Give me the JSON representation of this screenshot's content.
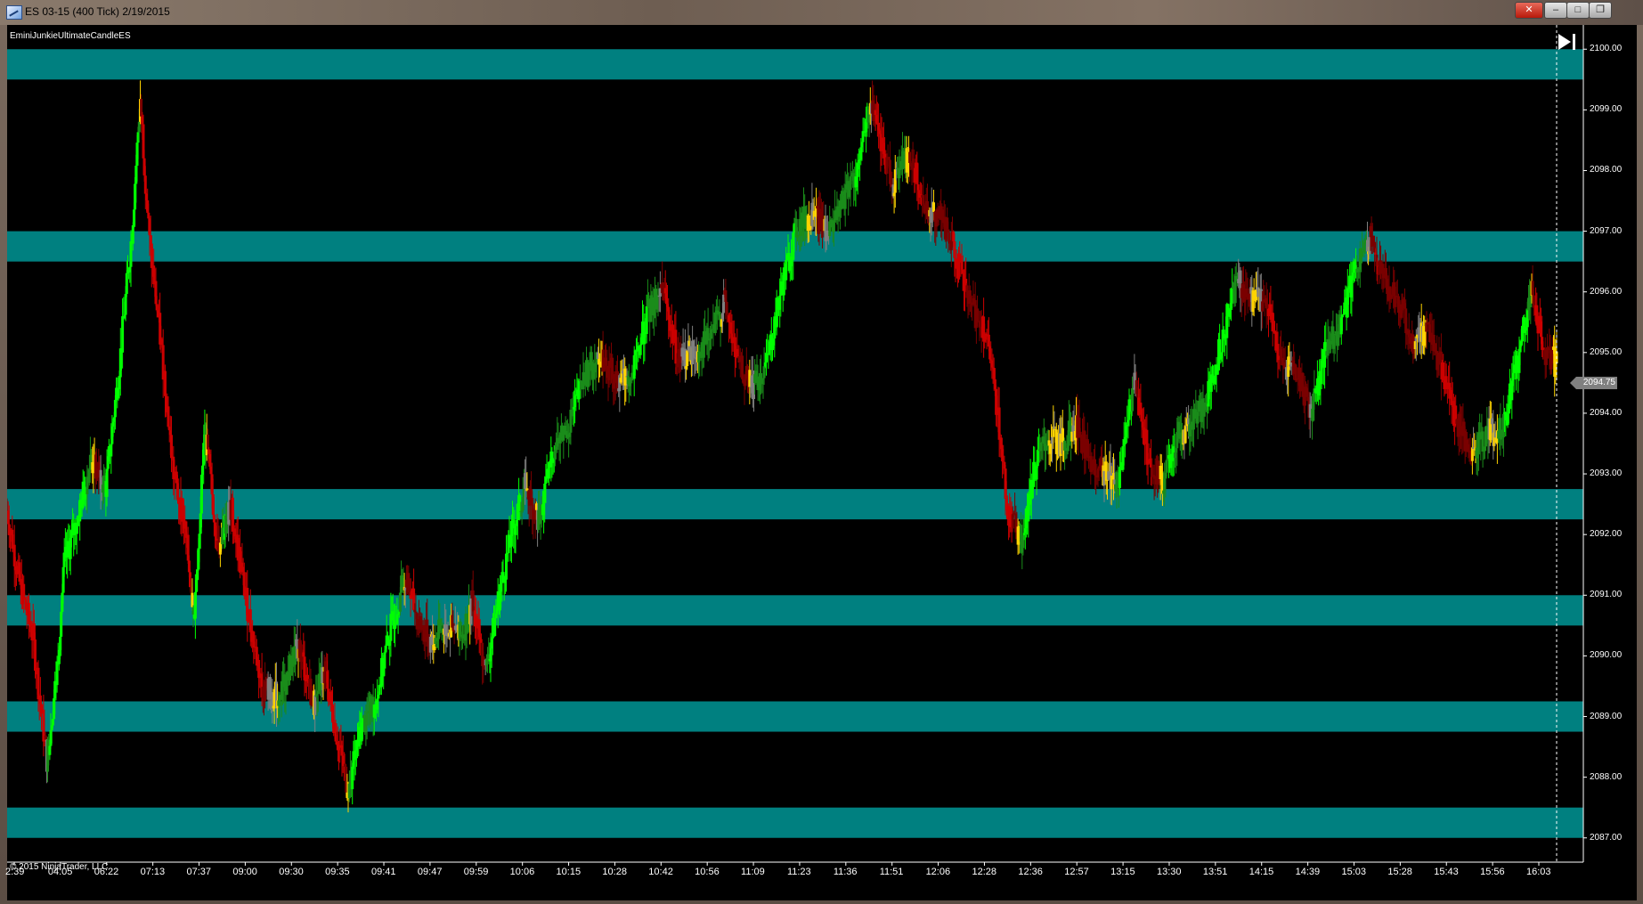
{
  "window": {
    "title": "ES 03-15 (400 Tick)  2/19/2015",
    "close_label": "✕",
    "min_label": "–",
    "max_label": "□",
    "restore_label": "❐"
  },
  "chart": {
    "indicator_label": "EminiJunkieUltimateCandleES",
    "copyright": "© 2015 NinjaTrader, LLC",
    "last_price_label": "2094.75",
    "scroll_end_icon": "skip-to-end-icon"
  },
  "colors": {
    "background": "#000000",
    "zone": "#008080",
    "up_strong": "#00ff00",
    "up_weak": "#1a8c1a",
    "up_pale": "#4dffb0",
    "down_strong": "#cc0000",
    "down_weak": "#7a0000",
    "neutral": "#ffd400",
    "grey": "#808080",
    "axis_text": "#ffffff"
  },
  "chart_data": {
    "type": "candlestick",
    "instrument": "ES 03-15",
    "period": "400 Tick",
    "date": "2/19/2015",
    "ylim": [
      2086.6,
      2100.4
    ],
    "y_ticks": [
      2087.0,
      2088.0,
      2089.0,
      2090.0,
      2091.0,
      2092.0,
      2093.0,
      2094.0,
      2095.0,
      2096.0,
      2097.0,
      2098.0,
      2099.0,
      2100.0
    ],
    "y_tick_labels": [
      "2087.00",
      "2088.00",
      "2089.00",
      "2090.00",
      "2091.00",
      "2092.00",
      "2093.00",
      "2094.00",
      "2095.00",
      "2096.00",
      "2097.00",
      "2098.00",
      "2099.00",
      "2100.00"
    ],
    "x_tick_labels": [
      "2:39",
      "04:05",
      "06:22",
      "07:13",
      "07:37",
      "09:00",
      "09:30",
      "09:35",
      "09:41",
      "09:47",
      "09:59",
      "10:06",
      "10:15",
      "10:28",
      "10:42",
      "10:56",
      "11:09",
      "11:23",
      "11:36",
      "11:51",
      "12:06",
      "12:28",
      "12:36",
      "12:57",
      "13:15",
      "13:30",
      "13:51",
      "14:15",
      "14:39",
      "15:03",
      "15:28",
      "15:43",
      "15:56",
      "16:03"
    ],
    "zones": [
      {
        "low": 2099.5,
        "high": 2100.0
      },
      {
        "low": 2096.5,
        "high": 2097.0
      },
      {
        "low": 2092.25,
        "high": 2092.75
      },
      {
        "low": 2090.5,
        "high": 2091.0
      },
      {
        "low": 2088.75,
        "high": 2089.25
      },
      {
        "low": 2087.0,
        "high": 2087.5
      }
    ],
    "last_price": 2094.75,
    "price_path": [
      [
        0,
        2092.4
      ],
      [
        12,
        2091.2
      ],
      [
        25,
        2090.3
      ],
      [
        38,
        2088.3
      ],
      [
        47,
        2089.6
      ],
      [
        55,
        2091.5
      ],
      [
        68,
        2092.3
      ],
      [
        80,
        2093.2
      ],
      [
        95,
        2092.8
      ],
      [
        108,
        2094.8
      ],
      [
        120,
        2097.0
      ],
      [
        128,
        2099.2
      ],
      [
        137,
        2096.8
      ],
      [
        150,
        2094.8
      ],
      [
        160,
        2093.0
      ],
      [
        170,
        2092.2
      ],
      [
        180,
        2090.7
      ],
      [
        190,
        2093.7
      ],
      [
        203,
        2091.8
      ],
      [
        215,
        2092.5
      ],
      [
        230,
        2090.9
      ],
      [
        245,
        2089.5
      ],
      [
        262,
        2089.3
      ],
      [
        280,
        2090.2
      ],
      [
        295,
        2089.2
      ],
      [
        305,
        2089.8
      ],
      [
        318,
        2088.6
      ],
      [
        328,
        2087.8
      ],
      [
        340,
        2088.8
      ],
      [
        355,
        2089.3
      ],
      [
        368,
        2090.4
      ],
      [
        382,
        2091.3
      ],
      [
        395,
        2090.6
      ],
      [
        408,
        2090.2
      ],
      [
        422,
        2090.5
      ],
      [
        436,
        2090.3
      ],
      [
        448,
        2090.9
      ],
      [
        460,
        2089.7
      ],
      [
        472,
        2090.9
      ],
      [
        485,
        2092.0
      ],
      [
        498,
        2092.8
      ],
      [
        512,
        2092.2
      ],
      [
        525,
        2093.4
      ],
      [
        540,
        2093.8
      ],
      [
        555,
        2094.6
      ],
      [
        570,
        2095.0
      ],
      [
        585,
        2094.6
      ],
      [
        600,
        2094.5
      ],
      [
        615,
        2095.6
      ],
      [
        630,
        2096.1
      ],
      [
        645,
        2094.9
      ],
      [
        660,
        2095.0
      ],
      [
        675,
        2095.2
      ],
      [
        690,
        2095.8
      ],
      [
        703,
        2094.8
      ],
      [
        716,
        2094.4
      ],
      [
        730,
        2094.8
      ],
      [
        745,
        2096.1
      ],
      [
        760,
        2097.1
      ],
      [
        775,
        2097.3
      ],
      [
        790,
        2097.0
      ],
      [
        805,
        2097.6
      ],
      [
        818,
        2098.0
      ],
      [
        830,
        2099.1
      ],
      [
        840,
        2098.4
      ],
      [
        852,
        2097.8
      ],
      [
        868,
        2098.3
      ],
      [
        882,
        2097.4
      ],
      [
        896,
        2097.3
      ],
      [
        910,
        2096.7
      ],
      [
        925,
        2095.8
      ],
      [
        940,
        2095.4
      ],
      [
        952,
        2094.1
      ],
      [
        962,
        2092.4
      ],
      [
        975,
        2091.9
      ],
      [
        988,
        2093.1
      ],
      [
        1000,
        2093.6
      ],
      [
        1015,
        2093.5
      ],
      [
        1028,
        2093.8
      ],
      [
        1042,
        2093.2
      ],
      [
        1056,
        2093.0
      ],
      [
        1070,
        2092.9
      ],
      [
        1084,
        2094.6
      ],
      [
        1098,
        2093.2
      ],
      [
        1112,
        2092.8
      ],
      [
        1126,
        2093.7
      ],
      [
        1140,
        2093.8
      ],
      [
        1155,
        2094.3
      ],
      [
        1168,
        2095.2
      ],
      [
        1182,
        2096.2
      ],
      [
        1196,
        2095.9
      ],
      [
        1210,
        2095.9
      ],
      [
        1225,
        2094.8
      ],
      [
        1240,
        2094.7
      ],
      [
        1255,
        2094.0
      ],
      [
        1268,
        2095.1
      ],
      [
        1282,
        2095.4
      ],
      [
        1296,
        2096.4
      ],
      [
        1310,
        2096.9
      ],
      [
        1324,
        2096.2
      ],
      [
        1338,
        2095.8
      ],
      [
        1352,
        2095.2
      ],
      [
        1366,
        2095.3
      ],
      [
        1380,
        2094.7
      ],
      [
        1395,
        2093.8
      ],
      [
        1410,
        2093.3
      ],
      [
        1424,
        2093.7
      ],
      [
        1438,
        2093.7
      ],
      [
        1452,
        2094.8
      ],
      [
        1466,
        2096.1
      ],
      [
        1478,
        2095.0
      ],
      [
        1490,
        2094.8
      ]
    ]
  }
}
